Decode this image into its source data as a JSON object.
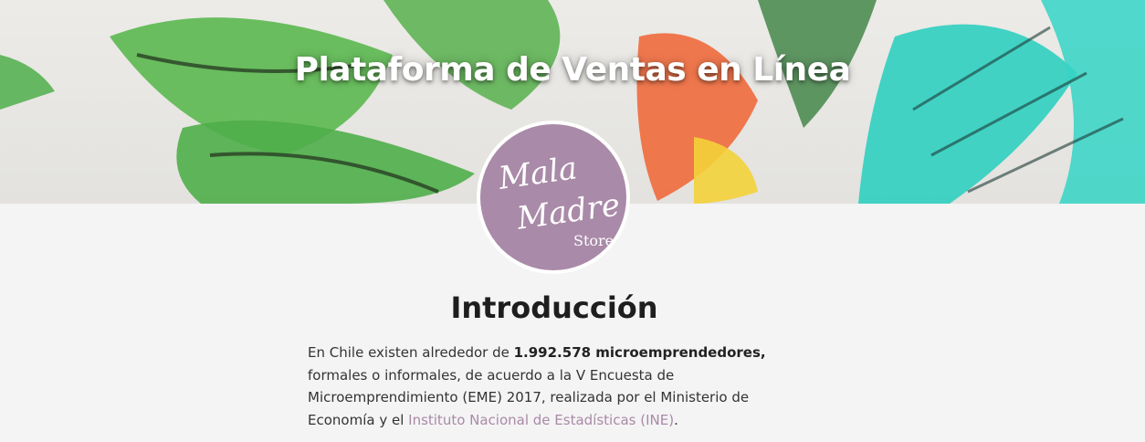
{
  "hero": {
    "title": "Plataforma de Ventas en Línea"
  },
  "logo": {
    "line1": "Mala",
    "line2": "Madre",
    "line3": "Store",
    "circle_color": "#a98aa8"
  },
  "intro": {
    "heading": "Introducción",
    "text_1": "En Chile existen alrededor de ",
    "bold_1": "1.992.578 microemprendedores,",
    "text_2": " formales o informales, de acuerdo a la V Encuesta de Microemprendimiento (EME) 2017, realizada por el Ministerio de Economía y el ",
    "link_1": "Instituto Nacional de Estadísticas (INE)",
    "text_3": "."
  },
  "colors": {
    "background": "#f4f4f4",
    "accent": "#a98aa8",
    "leaf_green": "#4fae4a",
    "leaf_teal": "#2fcfc0",
    "flower_orange": "#f06a3c"
  }
}
